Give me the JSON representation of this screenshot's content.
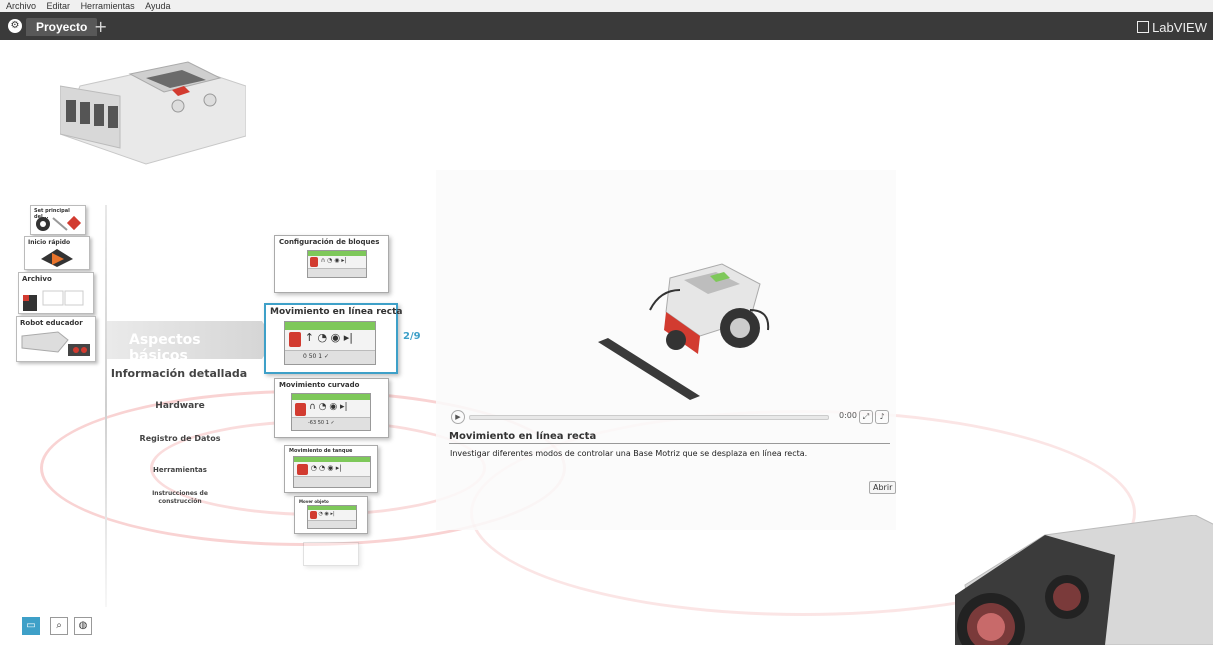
{
  "menu": [
    "Archivo",
    "Editar",
    "Herramientas",
    "Ayuda"
  ],
  "tabs": {
    "project_label": "Proyecto",
    "add_label": "+"
  },
  "brand": "LabVIEW",
  "left_cards": [
    {
      "label": "Set principal del..."
    },
    {
      "label": "Inicio rápido"
    },
    {
      "label": "Archivo"
    },
    {
      "label": "Robot educador"
    }
  ],
  "nav": {
    "selected": "Aspectos básicos",
    "items": [
      "Información detallada",
      "Hardware",
      "Registro de Datos",
      "Herramientas",
      "Instrucciones de construcción"
    ]
  },
  "lessons": [
    {
      "title": "Configuración de bloques"
    },
    {
      "title": "Movimiento en línea recta"
    },
    {
      "title": "Movimiento curvado"
    },
    {
      "title": "Movimiento de tanque"
    },
    {
      "title": "Mover objeto"
    }
  ],
  "block_labels": {
    "card1_values": "0  50  1  ✓",
    "card2_values": "-63  50  1  ✓"
  },
  "page_indicator": "2/9",
  "player": {
    "time": "0:00"
  },
  "detail": {
    "title": "Movimiento en línea recta",
    "description": "Investigar diferentes modos de controlar una Base Motriz que se desplaza en línea recta.",
    "open_label": "Abrir"
  },
  "colors": {
    "accent": "#3ea0c8",
    "tabbar": "#3a3a3a",
    "swirl": "#e65050"
  },
  "icons": [
    "project-icon",
    "labview-icon",
    "play-icon",
    "fullscreen-icon",
    "volume-icon",
    "content-icon",
    "search-icon",
    "globe-icon"
  ]
}
